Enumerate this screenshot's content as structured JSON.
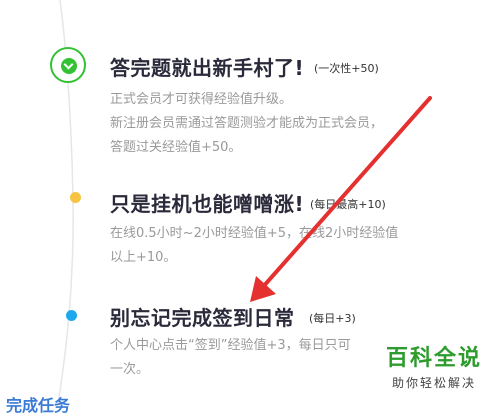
{
  "steps": [
    {
      "title": "答完题就出新手村了!",
      "badge": "(一次性+50)",
      "desc": [
        "正式会员才可获得经验值升级。",
        "新注册会员需通过答题测验才能成为正式会员，",
        "答题过关经验值+50。"
      ],
      "status": "completed",
      "color": "#33c233"
    },
    {
      "title": "只是挂机也能噌噌涨!",
      "badge": "(每日最高+10)",
      "desc": [
        "在线0.5小时~2小时经验值+5，在线2小时经验值",
        "以上+10。"
      ],
      "status": "pending",
      "color": "#f7c342"
    },
    {
      "title": "别忘记完成签到日常",
      "badge": "(每日+3)",
      "desc": [
        "个人中心点击“签到”经验值+3，每日只可",
        "一次。"
      ],
      "status": "pending",
      "color": "#1ea8ee"
    }
  ],
  "watermark": {
    "title": "百科全说",
    "subtitle": "助你轻松解决"
  },
  "bottom_link": "完成任务",
  "icons": {
    "step1": "check-icon",
    "arrow": "red-arrow-annotation"
  },
  "colors": {
    "arrow": "#e53030",
    "green": "#33c233"
  }
}
